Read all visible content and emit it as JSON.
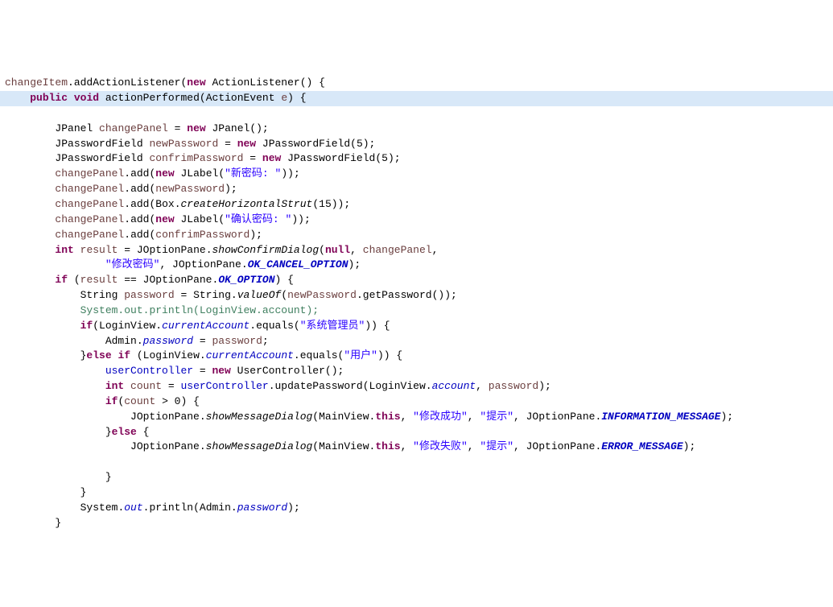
{
  "strings": {
    "newPwd": "\"新密码: \"",
    "confirm": "\"确认密码: \"",
    "dlgTitle": "\"修改密码\"",
    "sysAdmin": "\"系统管理员\"",
    "userRole": "\"用户\"",
    "okMsg": "\"修改成功\"",
    "failMsg": "\"修改失败\"",
    "tip": "\"提示\""
  },
  "kw": {
    "public": "public",
    "void": "void",
    "new": "new",
    "int": "int",
    "if": "if",
    "else": "else",
    "null": "null",
    "this": "this"
  },
  "id": {
    "changeItem": "changeItem",
    "addActionListener": "addActionListener",
    "ActionListener": "ActionListener",
    "actionPerformed": "actionPerformed",
    "ActionEvent": "ActionEvent",
    "e": "e",
    "JPanel": "JPanel",
    "changePanel": "changePanel",
    "JPasswordField": "JPasswordField",
    "newPassword": "newPassword",
    "confrimPassword": "confrimPassword",
    "add": "add",
    "JLabel": "JLabel",
    "Box": "Box",
    "createHorizontalStrut": "createHorizontalStrut",
    "result": "result",
    "JOptionPane": "JOptionPane",
    "showConfirmDialog": "showConfirmDialog",
    "OK_CANCEL_OPTION": "OK_CANCEL_OPTION",
    "OK_OPTION": "OK_OPTION",
    "String": "String",
    "password": "password",
    "valueOf": "valueOf",
    "getPassword": "getPassword",
    "System": "System",
    "out": "out",
    "println": "println",
    "LoginView": "LoginView",
    "account": "account",
    "currentAccount": "currentAccount",
    "equals": "equals",
    "Admin": "Admin",
    "userController": "userController",
    "UserController": "UserController",
    "count": "count",
    "updatePassword": "updatePassword",
    "MainView": "MainView",
    "showMessageDialog": "showMessageDialog",
    "INFORMATION_MESSAGE": "INFORMATION_MESSAGE",
    "ERROR_MESSAGE": "ERROR_MESSAGE"
  },
  "num": {
    "n5": "5",
    "n15": "15",
    "n0": "0"
  }
}
